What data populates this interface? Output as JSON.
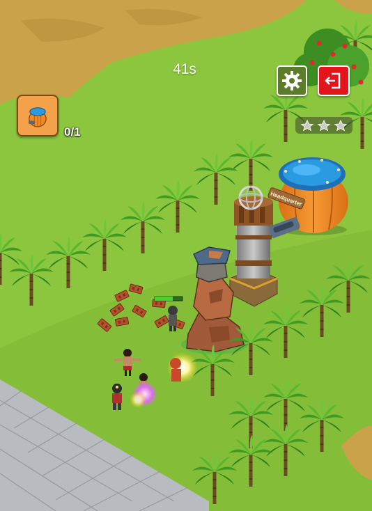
{
  "hud": {
    "timer": "41s",
    "quest_progress": "0/1",
    "quest_icon": "pumpkin-house-icon",
    "settings_icon": "gear-icon",
    "exit_icon": "exit-door-icon",
    "stars_earned": 0,
    "stars_total": 3
  },
  "buildings": {
    "headquarter_sign": "Headquarter"
  },
  "colors": {
    "grass": "#8cc63f",
    "dirt": "#c9a24a",
    "stone": "#b8bcc0",
    "exit_button": "#e3141b",
    "settings_button": "#5b7d2a",
    "quest_card": "#f4a24a",
    "pool_water": "#2a9be0",
    "pumpkin": "#f08a24"
  }
}
